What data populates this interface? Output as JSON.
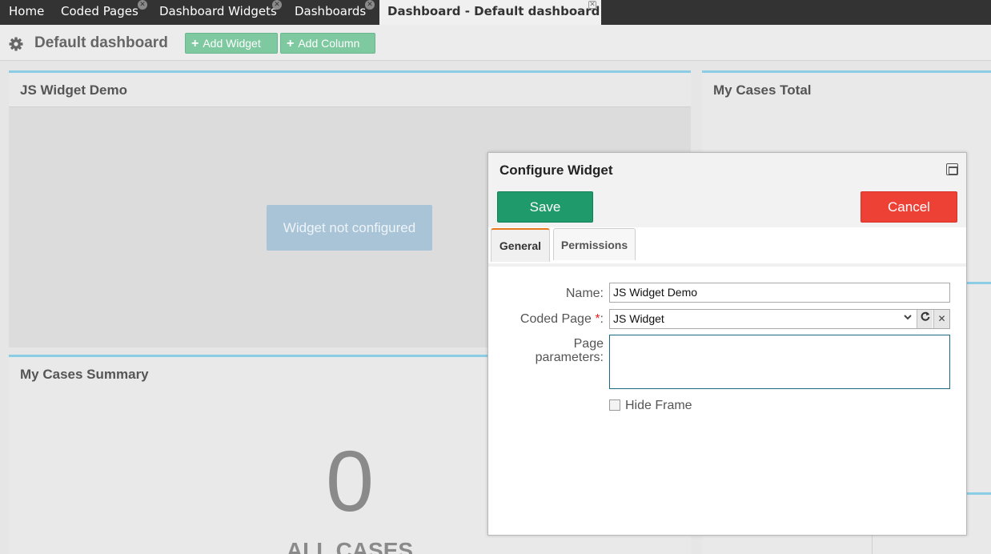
{
  "tabs": [
    {
      "label": "Home",
      "closable": false
    },
    {
      "label": "Coded Pages",
      "closable": true
    },
    {
      "label": "Dashboard Widgets",
      "closable": true
    },
    {
      "label": "Dashboards",
      "closable": true
    },
    {
      "label": "Dashboard - Default dashboard",
      "closable": true,
      "active": true
    }
  ],
  "header": {
    "title": "Default dashboard",
    "add_widget_label": "Add Widget",
    "add_column_label": "Add Column"
  },
  "widgets": {
    "js_demo": {
      "title": "JS Widget Demo",
      "status": "Widget not configured"
    },
    "cases_summary": {
      "title": "My Cases Summary",
      "count": "0",
      "caption": "ALL CASES"
    },
    "cases_total": {
      "title": "My Cases Total"
    }
  },
  "dialog": {
    "title": "Configure Widget",
    "save_label": "Save",
    "cancel_label": "Cancel",
    "tabs": [
      "General",
      "Permissions"
    ],
    "selected_tab": "General",
    "fields": {
      "name_label": "Name:",
      "name_value": "JS Widget Demo",
      "coded_page_label": "Coded Page",
      "required_mark": "*",
      "coded_page_colon": ":",
      "coded_page_value": "JS Widget",
      "page_params_label_line1": "Page",
      "page_params_label_line2": "parameters:",
      "page_params_value": "",
      "hide_frame_label": "Hide Frame",
      "hide_frame_checked": false
    }
  },
  "colors": {
    "tabbar": "#333333",
    "accent_green": "#1f9a6b",
    "cancel_red": "#ee4136",
    "widget_top_border": "#8ccde6",
    "active_tab_accent": "#e8781e"
  }
}
